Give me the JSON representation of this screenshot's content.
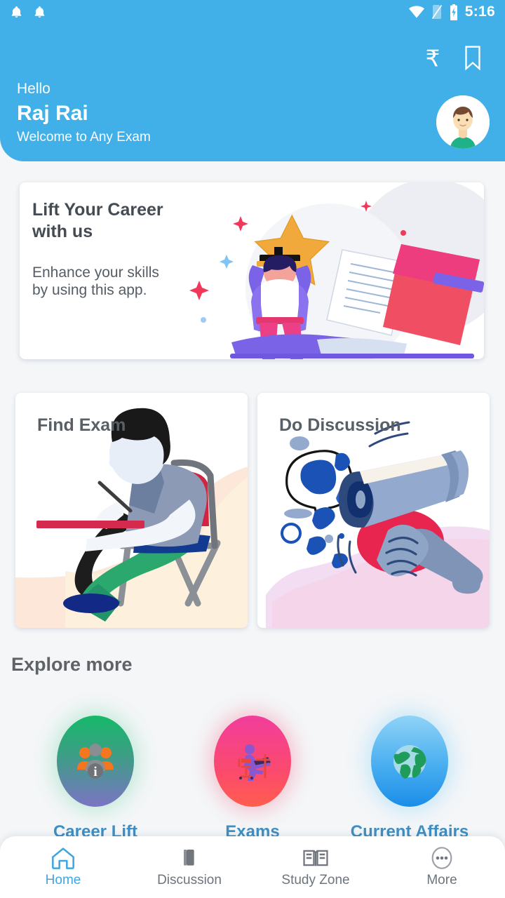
{
  "statusbar": {
    "time": "5:16",
    "icons": [
      "bell-icon",
      "bell-icon",
      "wifi-icon",
      "no-sim-icon",
      "battery-charging-icon"
    ]
  },
  "header": {
    "greeting": "Hello",
    "user_name": "Raj Rai",
    "subtitle": "Welcome to Any Exam",
    "rupee_icon": "rupee-icon",
    "bookmark_icon": "bookmark-icon",
    "avatar": "user-avatar",
    "background_color": "#41b0e8"
  },
  "banner": {
    "title": "Lift Your Career with us",
    "description": "Enhance your skills by using this app.",
    "illustration": "person-holding-star-trophy"
  },
  "feature_cards": [
    {
      "title": "Find Exam",
      "illustration": "student-writing-exam"
    },
    {
      "title": "Do Discussion",
      "illustration": "hand-holding-megaphone"
    }
  ],
  "explore": {
    "heading": "Explore more",
    "items": [
      {
        "label": "Career Lift",
        "icon": "people-group-icon",
        "color": "#16b96a"
      },
      {
        "label": "Exams",
        "icon": "person-at-desk-icon",
        "color": "#fb4a6e"
      },
      {
        "label": "Current Affairs",
        "icon": "globe-icon",
        "color": "#49aef0"
      }
    ]
  },
  "bottom_nav": {
    "active_color": "#41a6e0",
    "items": [
      {
        "label": "Home",
        "icon": "home-icon",
        "active": true
      },
      {
        "label": "Discussion",
        "icon": "books-icon",
        "active": false
      },
      {
        "label": "Study Zone",
        "icon": "open-book-icon",
        "active": false
      },
      {
        "label": "More",
        "icon": "more-dots-icon",
        "active": false
      }
    ]
  }
}
